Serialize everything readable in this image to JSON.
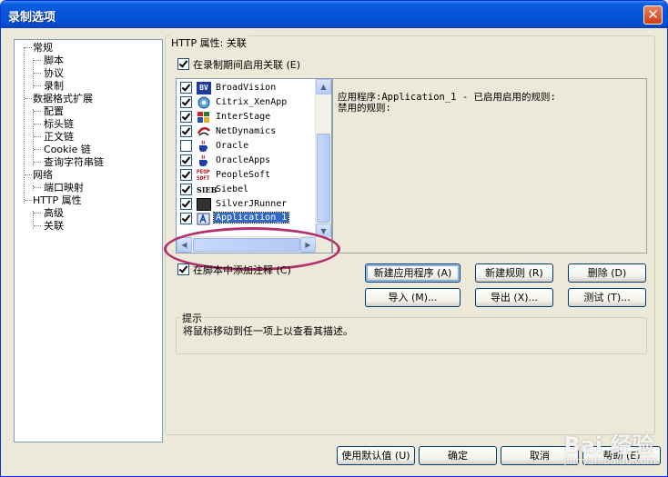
{
  "window": {
    "title": "录制选项",
    "close_glyph": "✕"
  },
  "tree": [
    {
      "label": "常规"
    },
    {
      "label": "脚本"
    },
    {
      "label": "协议"
    },
    {
      "label": "录制"
    },
    {
      "label": "数据格式扩展"
    },
    {
      "label": "配置"
    },
    {
      "label": "标头链"
    },
    {
      "label": "正文链"
    },
    {
      "label": "Cookie 链"
    },
    {
      "label": "查询字符串链"
    },
    {
      "label": "网络"
    },
    {
      "label": "端口映射"
    },
    {
      "label": "HTTP 属性"
    },
    {
      "label": "高级"
    },
    {
      "label": "关联"
    }
  ],
  "panel": {
    "section_title": "HTTP 属性: 关联",
    "enable_label": "在录制期间启用关联 (E)",
    "enable_checked": true,
    "list": [
      {
        "label": "BroadVision",
        "checked": true,
        "icon": "broadvision-icon"
      },
      {
        "label": "Citrix_XenApp",
        "checked": true,
        "icon": "citrix-icon"
      },
      {
        "label": "InterStage",
        "checked": true,
        "icon": "interstage-icon"
      },
      {
        "label": "NetDynamics",
        "checked": true,
        "icon": "netdynamics-icon"
      },
      {
        "label": "Oracle",
        "checked": false,
        "icon": "java-cup-icon"
      },
      {
        "label": "OracleApps",
        "checked": true,
        "icon": "java-cup-icon"
      },
      {
        "label": "PeopleSoft",
        "checked": true,
        "icon": "peoplesoft-icon"
      },
      {
        "label": "Siebel",
        "checked": true,
        "icon": "siebel-icon"
      },
      {
        "label": "SilverJRunner",
        "checked": true,
        "icon": "silverjrunner-icon"
      },
      {
        "label": "Application_1",
        "checked": true,
        "icon": "application-icon",
        "selected": true
      }
    ],
    "info_line1": "应用程序:Application_1 - 已启用启用的规则:",
    "info_line2": "禁用的规则:",
    "add_comments_label": "在脚本中添加注释 (C)",
    "add_comments_checked": true,
    "buttons": {
      "new_app": "新建应用程序 (A)",
      "new_rule": "新建规则 (R)",
      "delete": "删除 (D)",
      "import": "导入 (M)...",
      "export": "导出 (X)...",
      "test": "测试 (T)..."
    },
    "hint_title": "提示",
    "hint_text": "将鼠标移动到任一项上以查看其描述。"
  },
  "footer": {
    "use_defaults": "使用默认值 (U)",
    "ok": "确定",
    "cancel": "取消",
    "help": "帮助 (E)"
  },
  "watermark": {
    "text": "Bai 经验",
    "sub": "jingyan.baidu.com"
  }
}
